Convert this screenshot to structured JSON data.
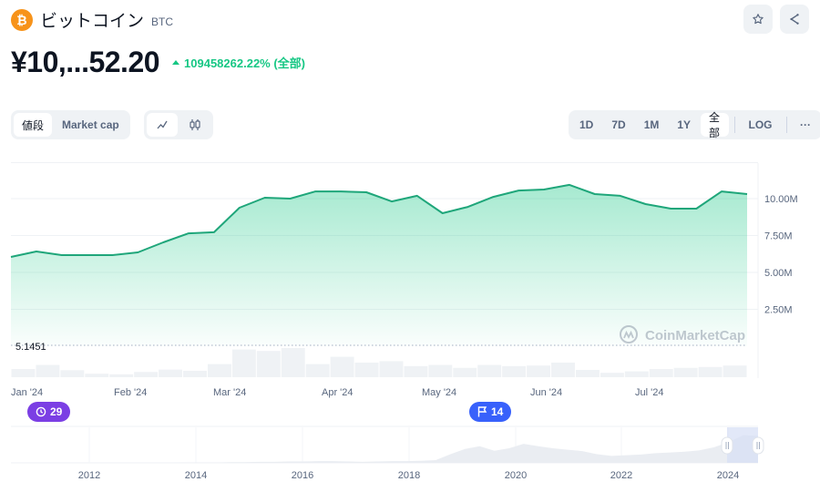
{
  "header": {
    "coin_name": "ビットコイン",
    "coin_symbol": "BTC",
    "logo_glyph": "₿",
    "favorite_icon": "star-icon",
    "share_icon": "share-icon"
  },
  "price": {
    "value": "¥10,...52.20",
    "change": "109458262.22% (全部)",
    "change_direction": "up",
    "change_color": "#16c784"
  },
  "controls": {
    "data_type_tabs": [
      {
        "label": "値段",
        "active": true
      },
      {
        "label": "Market cap",
        "active": false
      }
    ],
    "chart_type_tabs": [
      {
        "icon": "line-chart-icon",
        "active": true
      },
      {
        "icon": "candlestick-icon",
        "active": false
      }
    ],
    "range_tabs": [
      {
        "label": "1D",
        "active": false
      },
      {
        "label": "7D",
        "active": false
      },
      {
        "label": "1M",
        "active": false
      },
      {
        "label": "1Y",
        "active": false
      },
      {
        "label": "全部",
        "active": true
      }
    ],
    "log_label": "LOG",
    "more_label": "···"
  },
  "badges": {
    "history_count": "29",
    "flag_count": "14"
  },
  "chart_data": {
    "type": "area",
    "title": "",
    "xlabel": "",
    "ylabel": "",
    "line_color": "#16c784",
    "x_tick_labels": [
      "Jan '24",
      "Feb '24",
      "Mar '24",
      "Apr '24",
      "May '24",
      "Jun '24",
      "Jul '24"
    ],
    "y_tick_labels": [
      "10.00M",
      "7.50M",
      "5.00M",
      "2.50M"
    ],
    "y_ticks": [
      10000000,
      7500000,
      5000000,
      2500000
    ],
    "ylim": [
      0,
      11800000
    ],
    "grid": true,
    "start_price_label": "5.1451",
    "watermark": "CoinMarketCap",
    "series": [
      {
        "name": "Price (JPY)",
        "values": [
          6050000,
          6420000,
          6170000,
          6170000,
          6170000,
          6360000,
          7040000,
          7650000,
          7720000,
          9380000,
          10060000,
          10000000,
          10490000,
          10490000,
          10430000,
          9810000,
          10190000,
          9010000,
          9440000,
          10120000,
          10550000,
          10620000,
          10930000,
          10310000,
          10190000,
          9630000,
          9320000,
          9320000,
          10490000,
          10310000
        ]
      }
    ],
    "volume": [
      0.28,
      0.42,
      0.24,
      0.12,
      0.1,
      0.18,
      0.26,
      0.22,
      0.45,
      0.95,
      0.9,
      1.0,
      0.45,
      0.7,
      0.5,
      0.55,
      0.38,
      0.42,
      0.32,
      0.42,
      0.38,
      0.4,
      0.5,
      0.25,
      0.15,
      0.2,
      0.28,
      0.32,
      0.35,
      0.4
    ],
    "navigator": {
      "x_tick_labels": [
        "2012",
        "2014",
        "2016",
        "2018",
        "2020",
        "2022",
        "2024"
      ],
      "profile": [
        0,
        0,
        0,
        0,
        0,
        0,
        0,
        0,
        0,
        0,
        0,
        0,
        0.01,
        0.01,
        0.01,
        0.02,
        0.02,
        0.03,
        0.03,
        0.04,
        0.04,
        0.05,
        0.05,
        0.04,
        0.03,
        0.04,
        0.05,
        0.05,
        0.06,
        0.08,
        0.25,
        0.4,
        0.48,
        0.35,
        0.42,
        0.55,
        0.48,
        0.42,
        0.38,
        0.34,
        0.25,
        0.2,
        0.22,
        0.24,
        0.28,
        0.3,
        0.32,
        0.36,
        0.45,
        0.6,
        0.8,
        0.78
      ],
      "selected_range": "2024"
    }
  }
}
